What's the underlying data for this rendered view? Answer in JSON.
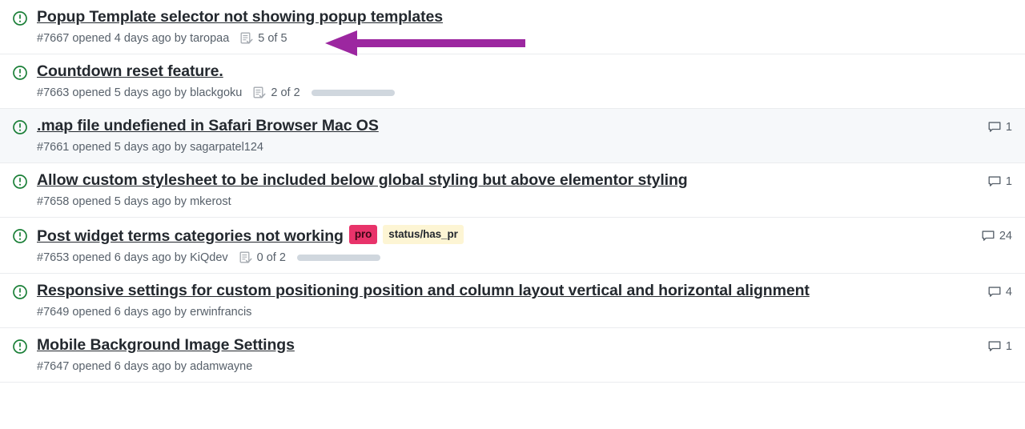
{
  "colors": {
    "open_issue_green": "#1a7f37",
    "meta_text": "#57606a",
    "title_text": "#24292f",
    "row_alt_background": "#f6f8fa",
    "row_background": "#ffffff",
    "divider": "#eaecef",
    "progress_bar": "#d0d7de",
    "annotation_purple": "#9c27a0",
    "label_pro_background": "#e8336a",
    "label_status_background": "#fdf5d4"
  },
  "icons": {
    "issue_open": "issue-opened-icon",
    "tasklist": "tasklist-icon",
    "comment": "comment-icon",
    "annotation": "left-arrow-annotation"
  },
  "issues": [
    {
      "title": "Popup Template selector not showing popup templates",
      "number": "#7667",
      "meta": "#7667 opened 4 days ago by taropaa",
      "tasks": "5 of 5",
      "has_tasks": true,
      "show_progress": false,
      "comments": "",
      "highlight": false,
      "labels": []
    },
    {
      "title": "Countdown reset feature.",
      "number": "#7663",
      "meta": "#7663 opened 5 days ago by blackgoku",
      "tasks": "2 of 2",
      "has_tasks": true,
      "show_progress": true,
      "comments": "",
      "highlight": false,
      "labels": []
    },
    {
      "title": ".map file undefiened in Safari Browser Mac OS",
      "number": "#7661",
      "meta": "#7661 opened 5 days ago by sagarpatel124",
      "tasks": "",
      "has_tasks": false,
      "show_progress": false,
      "comments": "1",
      "highlight": true,
      "labels": []
    },
    {
      "title": "Allow custom stylesheet to be included below global styling but above elementor styling",
      "number": "#7658",
      "meta": "#7658 opened 5 days ago by mkerost",
      "tasks": "",
      "has_tasks": false,
      "show_progress": false,
      "comments": "1",
      "highlight": false,
      "labels": []
    },
    {
      "title": "Post widget terms categories not working",
      "number": "#7653",
      "meta": "#7653 opened 6 days ago by KiQdev",
      "tasks": "0 of 2",
      "has_tasks": true,
      "show_progress": true,
      "comments": "24",
      "highlight": false,
      "labels": [
        {
          "text": "pro",
          "style": "pro"
        },
        {
          "text": "status/has_pr",
          "style": "status"
        }
      ]
    },
    {
      "title": "Responsive settings for custom positioning position and column layout vertical and horizontal alignment",
      "number": "#7649",
      "meta": "#7649 opened 6 days ago by erwinfrancis",
      "tasks": "",
      "has_tasks": false,
      "show_progress": false,
      "comments": "4",
      "highlight": false,
      "labels": []
    },
    {
      "title": "Mobile Background Image Settings",
      "number": "#7647",
      "meta": "#7647 opened 6 days ago by adamwayne",
      "tasks": "",
      "has_tasks": false,
      "show_progress": false,
      "comments": "1",
      "highlight": false,
      "labels": []
    }
  ]
}
